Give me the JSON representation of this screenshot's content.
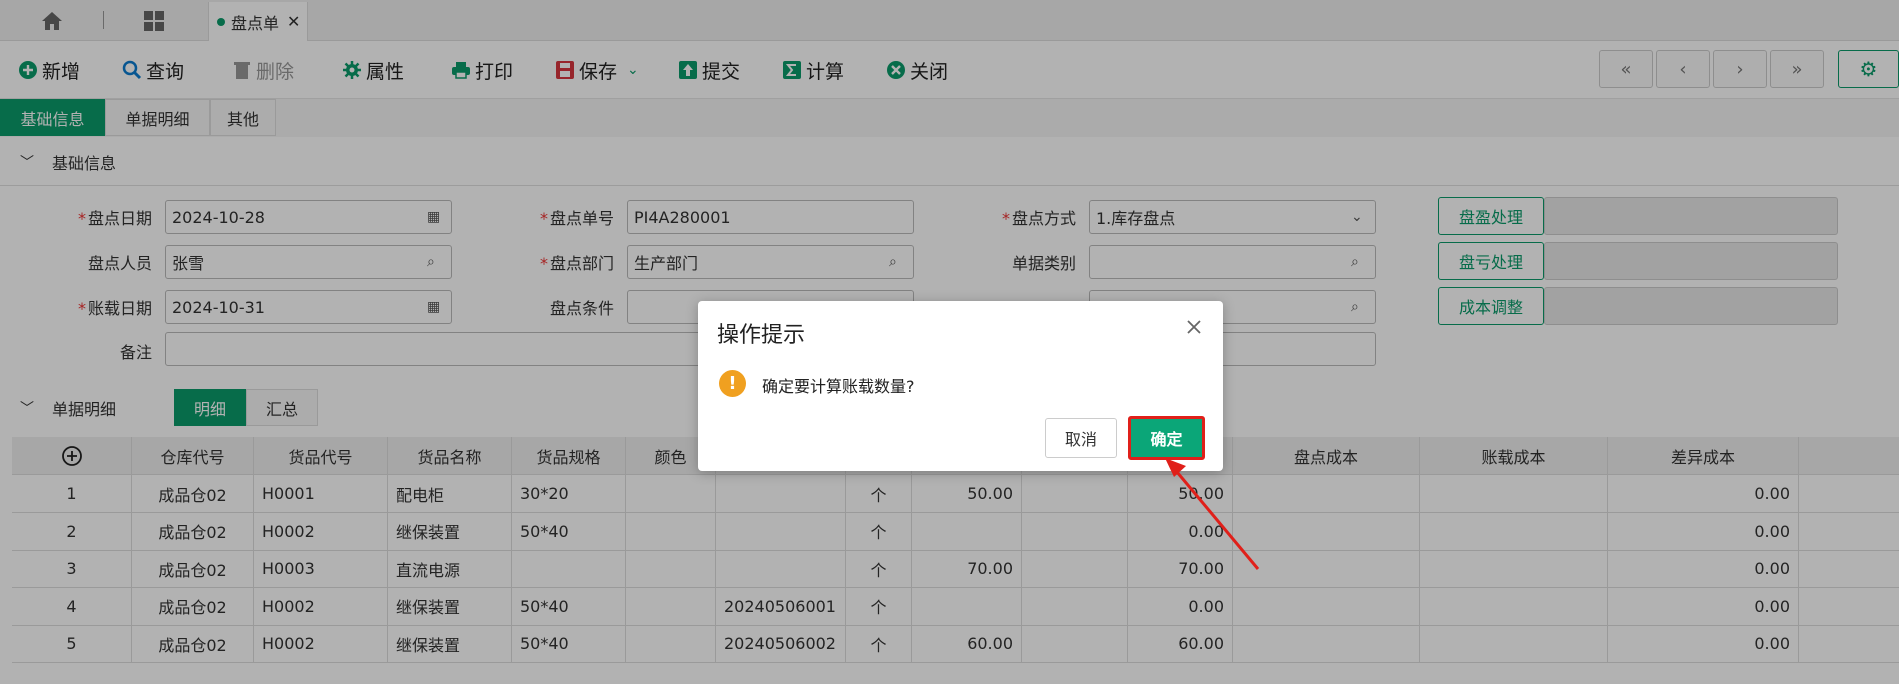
{
  "tabs": {
    "home_label": "",
    "active_tab": "盘点单"
  },
  "toolbar": {
    "new": "新增",
    "query": "查询",
    "delete": "删除",
    "properties": "属性",
    "print": "打印",
    "save": "保存",
    "submit": "提交",
    "calculate": "计算",
    "close": "关闭"
  },
  "section_tabs": [
    "基础信息",
    "单据明细",
    "其他"
  ],
  "basic": {
    "header": "基础信息",
    "fields": {
      "count_date_label": "盘点日期",
      "count_date": "2024-10-28",
      "count_no_label": "盘点单号",
      "count_no": "PI4A280001",
      "count_method_label": "盘点方式",
      "count_method": "1.库存盘点",
      "counter_label": "盘点人员",
      "counter": "张雪",
      "dept_label": "盘点部门",
      "dept": "生产部门",
      "doc_type_label": "单据类别",
      "doc_type": "",
      "book_date_label": "账载日期",
      "book_date": "2024-10-31",
      "condition_label": "盘点条件",
      "condition": "",
      "remark_label": "备注",
      "remark": ""
    },
    "side_buttons": [
      "盘盈处理",
      "盘亏处理",
      "成本调整"
    ]
  },
  "details": {
    "header": "单据明细",
    "subtabs": [
      "明细",
      "汇总"
    ],
    "columns": [
      "",
      "仓库代号",
      "货品代号",
      "货品名称",
      "货品规格",
      "颜色",
      "",
      "",
      "",
      "",
      "",
      "盘点成本",
      "账载成本",
      "差异成本"
    ],
    "rows": [
      [
        "1",
        "成品仓02",
        "H0001",
        "配电柜",
        "30*20",
        "",
        "",
        "个",
        "50.00",
        "",
        "50.00",
        "",
        "",
        "0.00"
      ],
      [
        "2",
        "成品仓02",
        "H0002",
        "继保装置",
        "50*40",
        "",
        "",
        "个",
        "",
        "",
        "0.00",
        "",
        "",
        "0.00"
      ],
      [
        "3",
        "成品仓02",
        "H0003",
        "直流电源",
        "",
        "",
        "",
        "个",
        "70.00",
        "",
        "70.00",
        "",
        "",
        "0.00"
      ],
      [
        "4",
        "成品仓02",
        "H0002",
        "继保装置",
        "50*40",
        "",
        "20240506001",
        "个",
        "",
        "",
        "0.00",
        "",
        "",
        "0.00"
      ],
      [
        "5",
        "成品仓02",
        "H0002",
        "继保装置",
        "50*40",
        "",
        "20240506002",
        "个",
        "60.00",
        "",
        "60.00",
        "",
        "",
        "0.00"
      ]
    ]
  },
  "dialog": {
    "title": "操作提示",
    "message": "确定要计算账载数量?",
    "cancel": "取消",
    "ok": "确定"
  },
  "colors": {
    "accent": "#0b9b6a",
    "highlight": "#e0201a"
  }
}
